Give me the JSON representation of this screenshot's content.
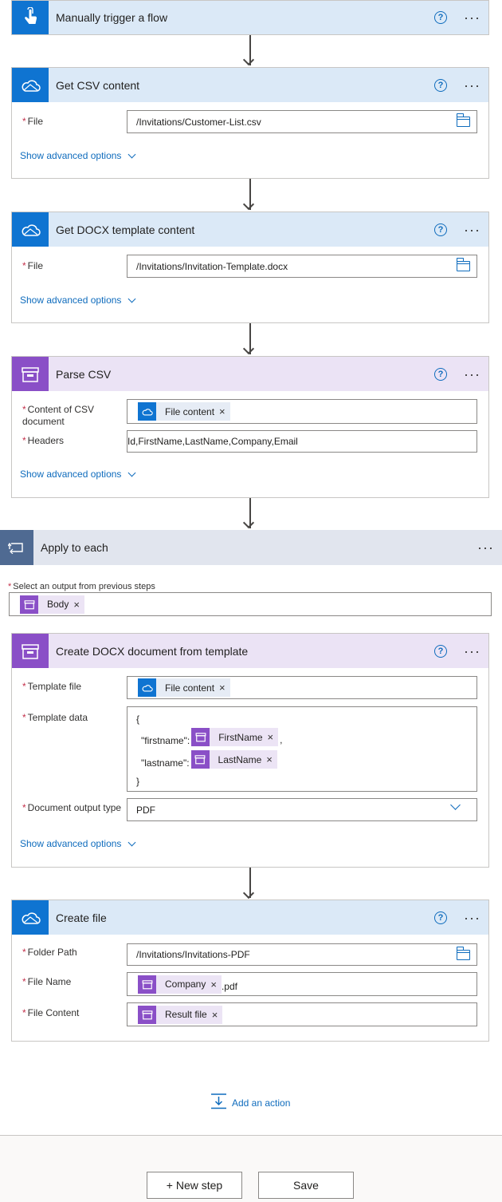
{
  "steps": {
    "trigger": {
      "title": "Manually trigger a flow"
    },
    "get_csv": {
      "title": "Get CSV content",
      "file_label": "File",
      "file_value": "/Invitations/Customer-List.csv",
      "advanced": "Show advanced options"
    },
    "get_docx": {
      "title": "Get DOCX template content",
      "file_label": "File",
      "file_value": "/Invitations/Invitation-Template.docx",
      "advanced": "Show advanced options"
    },
    "parse_csv": {
      "title": "Parse CSV",
      "content_label_1": "Content of CSV",
      "content_label_2": "document",
      "content_token": "File content",
      "headers_label": "Headers",
      "headers_value": "Id,FirstName,LastName,Company,Email",
      "advanced": "Show advanced options"
    },
    "apply_each": {
      "title": "Apply to each",
      "select_label": "Select an output from previous steps",
      "select_token": "Body"
    },
    "create_docx": {
      "title": "Create DOCX document from template",
      "template_file_label": "Template file",
      "template_file_token": "File content",
      "template_data_label": "Template data",
      "brace_open": "{",
      "firstname_key": "\"firstname\":",
      "firstname_token": "FirstName",
      "comma": ",",
      "lastname_key": "\"lastname\":",
      "lastname_token": "LastName",
      "brace_close": "}",
      "output_type_label": "Document output type",
      "output_type_value": "PDF",
      "advanced": "Show advanced options"
    },
    "create_file": {
      "title": "Create file",
      "folder_label": "Folder Path",
      "folder_value": "/Invitations/Invitations-PDF",
      "name_label": "File Name",
      "name_token": "Company",
      "name_suffix": ".pdf",
      "content_label": "File Content",
      "content_token": "Result file"
    }
  },
  "add_action": "Add an action",
  "new_step": "+ New step",
  "save": "Save",
  "required_mark": "*",
  "remove_mark": "×",
  "help_mark": "?",
  "more_mark": "···",
  "colors": {
    "accent": "#0f6cbd",
    "onedrive": "#0f74d1",
    "parse": "#8a4fc7",
    "loop": "#4f6a92",
    "required": "#c4314b"
  },
  "icons": [
    "touch-trigger-icon",
    "onedrive-cloud-icon",
    "document-cabinet-icon",
    "loop-icon",
    "folder-icon",
    "help-icon",
    "more-icon",
    "chevron-down-icon",
    "add-action-icon"
  ]
}
